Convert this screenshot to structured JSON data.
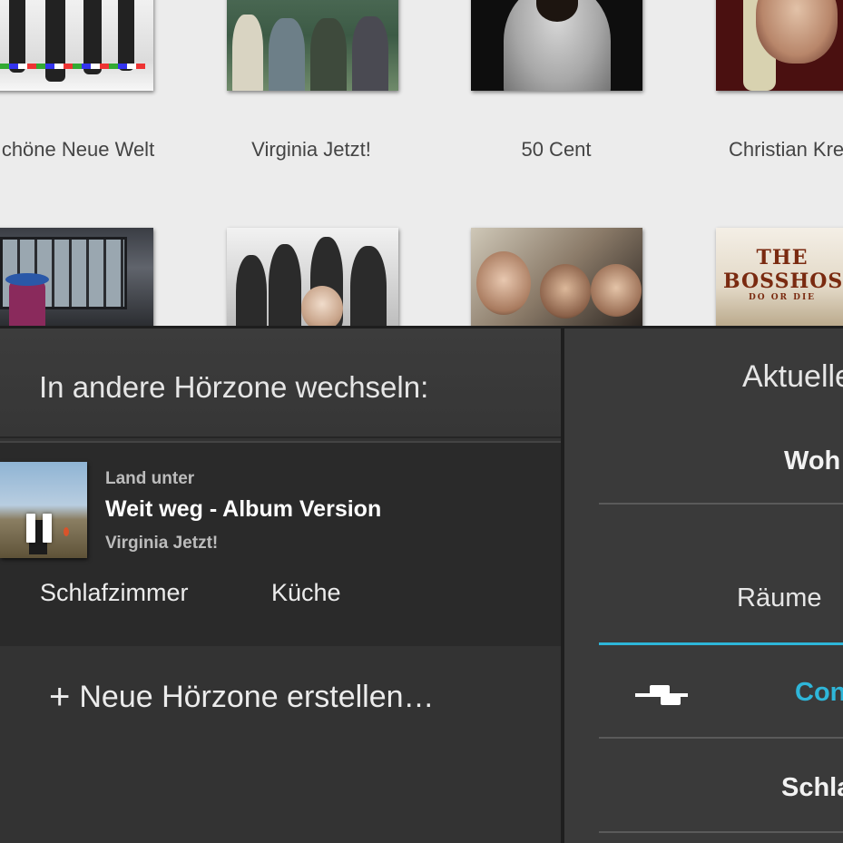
{
  "library": {
    "artists": [
      {
        "name": "chöne Neue Welt"
      },
      {
        "name": "Virginia Jetzt!"
      },
      {
        "name": "50 Cent"
      },
      {
        "name": "Christian Kre"
      }
    ],
    "album_logo": {
      "text": "THE BOSSHOSS",
      "subtext": "DO OR DIE"
    }
  },
  "zones_panel": {
    "title": "In andere Hörzone wechseln:",
    "now_playing": {
      "album": "Land unter",
      "track": "Weit weg - Album Version",
      "artist": "Virginia Jetzt!",
      "state_icon": "pause-icon"
    },
    "rooms": [
      "Schlafzimmer",
      "Küche"
    ],
    "new_zone": {
      "icon": "plus-icon",
      "label": "Neue Hörzone erstellen…"
    }
  },
  "right_panel": {
    "title": "Aktuelle",
    "zone": "Woh",
    "rooms_header": "Räume",
    "rooms": [
      {
        "label": "Con",
        "active": true,
        "icon": "equalizer-icon"
      },
      {
        "label": "Schla",
        "active": false
      }
    ],
    "accent_color": "#2eb6d9"
  }
}
